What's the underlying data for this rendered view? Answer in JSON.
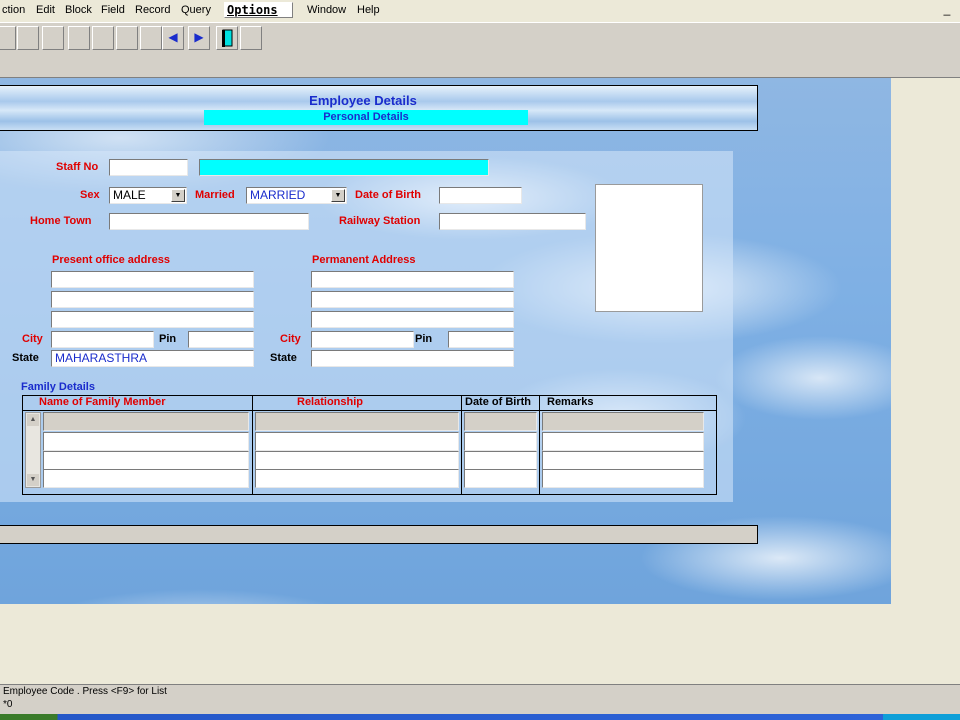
{
  "menu": {
    "items": [
      "ction",
      "Edit",
      "Block",
      "Field",
      "Record",
      "Query",
      "Options",
      "Window",
      "Help"
    ],
    "active": "Options",
    "minimize": "_"
  },
  "toolbar": {
    "prev_glyph": "◀",
    "next_glyph": "▶",
    "exit_icon": "door-exit-icon"
  },
  "form": {
    "title": "Employee Details",
    "subtitle": "Personal Details",
    "labels": {
      "staff_no": "Staff No",
      "sex": "Sex",
      "married": "Married",
      "dob": "Date of Birth",
      "home_town": "Home Town",
      "railway_station": "Railway Station",
      "present_address": "Present office address",
      "permanent_address": "Permanent Address",
      "city": "City",
      "pin": "Pin",
      "state": "State"
    },
    "values": {
      "staff_no": "",
      "staff_name": "",
      "sex": "MALE",
      "married": "MARRIED",
      "dob": "",
      "home_town": "",
      "railway_station": "",
      "present_state": "MAHARASTHRA",
      "permanent_state": ""
    }
  },
  "family": {
    "title": "Family Details",
    "columns": [
      "Name of Family Member",
      "Relationship",
      "Date of Birth",
      "Remarks"
    ]
  },
  "status": {
    "message": "Employee Code . Press <F9> for List",
    "count": "*0"
  },
  "colors": {
    "label_red": "#e00000",
    "label_blue": "#1a2ccc",
    "highlight_cyan": "#00ffff"
  }
}
